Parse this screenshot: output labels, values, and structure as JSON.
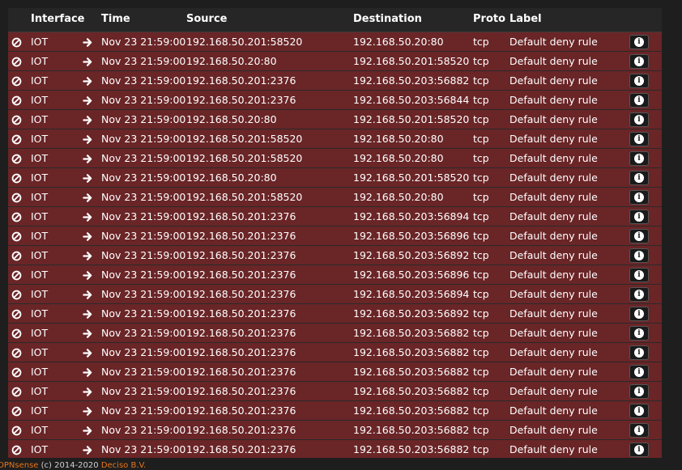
{
  "table": {
    "columns": {
      "interface": "Interface",
      "time": "Time",
      "source": "Source",
      "destination": "Destination",
      "proto": "Proto",
      "label": "Label"
    },
    "rows": [
      {
        "interface": "IOT",
        "time": "Nov 23 21:59:00",
        "source": "192.168.50.201:58520",
        "destination": "192.168.50.20:80",
        "proto": "tcp",
        "label": "Default deny rule"
      },
      {
        "interface": "IOT",
        "time": "Nov 23 21:59:00",
        "source": "192.168.50.20:80",
        "destination": "192.168.50.201:58520",
        "proto": "tcp",
        "label": "Default deny rule"
      },
      {
        "interface": "IOT",
        "time": "Nov 23 21:59:00",
        "source": "192.168.50.201:2376",
        "destination": "192.168.50.203:56882",
        "proto": "tcp",
        "label": "Default deny rule"
      },
      {
        "interface": "IOT",
        "time": "Nov 23 21:59:00",
        "source": "192.168.50.201:2376",
        "destination": "192.168.50.203:56844",
        "proto": "tcp",
        "label": "Default deny rule"
      },
      {
        "interface": "IOT",
        "time": "Nov 23 21:59:00",
        "source": "192.168.50.20:80",
        "destination": "192.168.50.201:58520",
        "proto": "tcp",
        "label": "Default deny rule"
      },
      {
        "interface": "IOT",
        "time": "Nov 23 21:59:00",
        "source": "192.168.50.201:58520",
        "destination": "192.168.50.20:80",
        "proto": "tcp",
        "label": "Default deny rule"
      },
      {
        "interface": "IOT",
        "time": "Nov 23 21:59:00",
        "source": "192.168.50.201:58520",
        "destination": "192.168.50.20:80",
        "proto": "tcp",
        "label": "Default deny rule"
      },
      {
        "interface": "IOT",
        "time": "Nov 23 21:59:00",
        "source": "192.168.50.20:80",
        "destination": "192.168.50.201:58520",
        "proto": "tcp",
        "label": "Default deny rule"
      },
      {
        "interface": "IOT",
        "time": "Nov 23 21:59:00",
        "source": "192.168.50.201:58520",
        "destination": "192.168.50.20:80",
        "proto": "tcp",
        "label": "Default deny rule"
      },
      {
        "interface": "IOT",
        "time": "Nov 23 21:59:00",
        "source": "192.168.50.201:2376",
        "destination": "192.168.50.203:56894",
        "proto": "tcp",
        "label": "Default deny rule"
      },
      {
        "interface": "IOT",
        "time": "Nov 23 21:59:00",
        "source": "192.168.50.201:2376",
        "destination": "192.168.50.203:56896",
        "proto": "tcp",
        "label": "Default deny rule"
      },
      {
        "interface": "IOT",
        "time": "Nov 23 21:59:00",
        "source": "192.168.50.201:2376",
        "destination": "192.168.50.203:56892",
        "proto": "tcp",
        "label": "Default deny rule"
      },
      {
        "interface": "IOT",
        "time": "Nov 23 21:59:00",
        "source": "192.168.50.201:2376",
        "destination": "192.168.50.203:56896",
        "proto": "tcp",
        "label": "Default deny rule"
      },
      {
        "interface": "IOT",
        "time": "Nov 23 21:59:00",
        "source": "192.168.50.201:2376",
        "destination": "192.168.50.203:56894",
        "proto": "tcp",
        "label": "Default deny rule"
      },
      {
        "interface": "IOT",
        "time": "Nov 23 21:59:00",
        "source": "192.168.50.201:2376",
        "destination": "192.168.50.203:56892",
        "proto": "tcp",
        "label": "Default deny rule"
      },
      {
        "interface": "IOT",
        "time": "Nov 23 21:59:00",
        "source": "192.168.50.201:2376",
        "destination": "192.168.50.203:56882",
        "proto": "tcp",
        "label": "Default deny rule"
      },
      {
        "interface": "IOT",
        "time": "Nov 23 21:59:00",
        "source": "192.168.50.201:2376",
        "destination": "192.168.50.203:56882",
        "proto": "tcp",
        "label": "Default deny rule"
      },
      {
        "interface": "IOT",
        "time": "Nov 23 21:59:00",
        "source": "192.168.50.201:2376",
        "destination": "192.168.50.203:56882",
        "proto": "tcp",
        "label": "Default deny rule"
      },
      {
        "interface": "IOT",
        "time": "Nov 23 21:59:00",
        "source": "192.168.50.201:2376",
        "destination": "192.168.50.203:56882",
        "proto": "tcp",
        "label": "Default deny rule"
      },
      {
        "interface": "IOT",
        "time": "Nov 23 21:59:00",
        "source": "192.168.50.201:2376",
        "destination": "192.168.50.203:56882",
        "proto": "tcp",
        "label": "Default deny rule"
      },
      {
        "interface": "IOT",
        "time": "Nov 23 21:59:00",
        "source": "192.168.50.201:2376",
        "destination": "192.168.50.203:56882",
        "proto": "tcp",
        "label": "Default deny rule"
      },
      {
        "interface": "IOT",
        "time": "Nov 23 21:59:00",
        "source": "192.168.50.201:2376",
        "destination": "192.168.50.203:56882",
        "proto": "tcp",
        "label": "Default deny rule"
      }
    ],
    "row_action_icons": {
      "block": "block-icon",
      "direction": "arrow-right-icon",
      "info": "info-icon"
    }
  },
  "footer": {
    "brand": "OPNsense",
    "copyright": "(c) 2014-2020",
    "company": "Deciso B.V."
  },
  "colors": {
    "row_blocked": "#6a2527",
    "accent": "#e8751a",
    "background": "#1e1e1e"
  }
}
